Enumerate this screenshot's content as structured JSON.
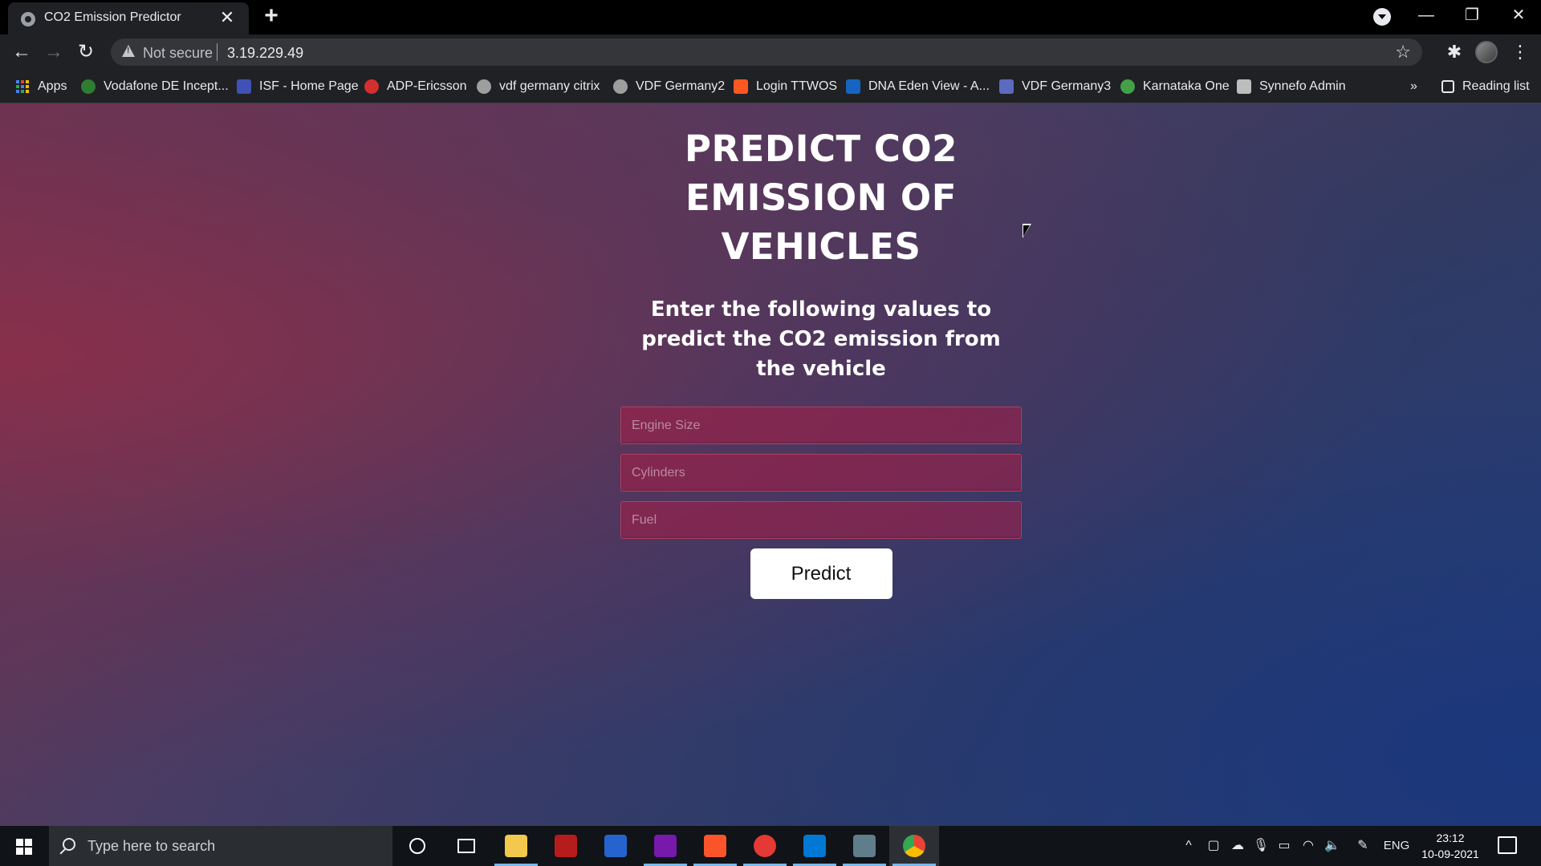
{
  "browser": {
    "tab_title": "CO2 Emission Predictor",
    "tab_close": "✕",
    "new_tab": "+",
    "window_controls": {
      "minimize": "—",
      "restore": "❐",
      "close": "✕"
    },
    "nav": {
      "back": "←",
      "forward": "→",
      "reload": "↻"
    },
    "security_label": "Not secure",
    "url": "3.19.229.49",
    "star": "☆",
    "extensions": "✱",
    "menu": "⋮"
  },
  "bookmarks": {
    "items": [
      {
        "label": "Apps",
        "color": "#4285f4"
      },
      {
        "label": "Vodafone DE Incept...",
        "color": "#2e7d32"
      },
      {
        "label": "ISF - Home Page",
        "color": "#3f51b5"
      },
      {
        "label": "ADP-Ericsson",
        "color": "#d32f2f"
      },
      {
        "label": "vdf germany citrix",
        "color": "#9e9e9e"
      },
      {
        "label": "VDF Germany2",
        "color": "#9e9e9e"
      },
      {
        "label": "Login TTWOS",
        "color": "#ff5722"
      },
      {
        "label": "DNA Eden View - A...",
        "color": "#1565c0"
      },
      {
        "label": "VDF Germany3",
        "color": "#5c6bc0"
      },
      {
        "label": "Karnataka One",
        "color": "#43a047"
      },
      {
        "label": "Synnefo Admin",
        "color": "#bdbdbd"
      }
    ],
    "overflow": "»",
    "reading_list": "Reading list"
  },
  "page": {
    "title": "PREDICT CO2 EMISSION OF VEHICLES",
    "subtitle": "Enter the following values to predict the CO2 emission from the vehicle",
    "fields": [
      {
        "placeholder": "Engine Size",
        "value": ""
      },
      {
        "placeholder": "Cylinders",
        "value": ""
      },
      {
        "placeholder": "Fuel",
        "value": ""
      }
    ],
    "predict_label": "Predict"
  },
  "taskbar": {
    "search_placeholder": "Type here to search",
    "language": "ENG",
    "time": "23:12",
    "date": "10-09-2021",
    "tray_overflow": "^"
  },
  "colors": {
    "accent": "#76b9ed",
    "field_bg": "#8a2244",
    "button_bg": "#ffffff"
  }
}
